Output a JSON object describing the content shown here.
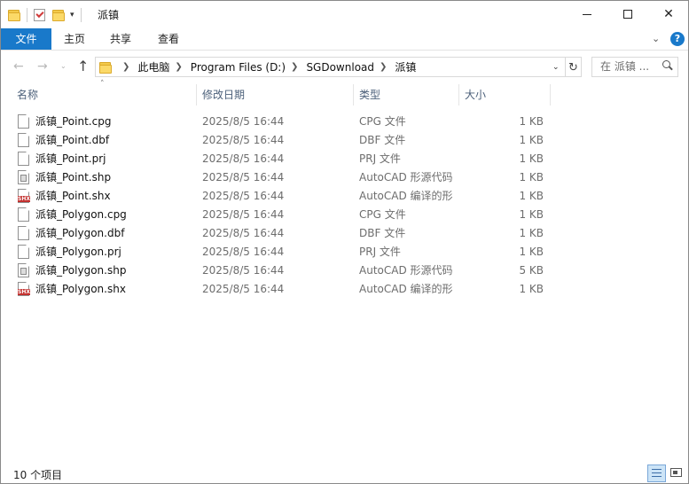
{
  "window": {
    "title": "派镇",
    "controls": {
      "minimize": "minimize",
      "maximize": "maximize",
      "close": "✕"
    }
  },
  "quick_access": {
    "dropdown": "▾"
  },
  "ribbon": {
    "tabs": [
      {
        "label": "文件",
        "active": true
      },
      {
        "label": "主页"
      },
      {
        "label": "共享"
      },
      {
        "label": "查看"
      }
    ],
    "expand": "⌄",
    "help": "?"
  },
  "navigation": {
    "back": "←",
    "forward": "→",
    "recent": "⌄",
    "up": "↑",
    "breadcrumb": [
      "此电脑",
      "Program Files (D:)",
      "SGDownload",
      "派镇"
    ],
    "address_dropdown": "⌄",
    "refresh": "↻",
    "search_placeholder": "在 派镇 ..."
  },
  "columns": [
    "名称",
    "修改日期",
    "类型",
    "大小"
  ],
  "sort_indicator": "˄",
  "files": [
    {
      "name": "派镇_Point.cpg",
      "date": "2025/8/5 16:44",
      "type": "CPG 文件",
      "size": "1 KB",
      "icon": "document-icon"
    },
    {
      "name": "派镇_Point.dbf",
      "date": "2025/8/5 16:44",
      "type": "DBF 文件",
      "size": "1 KB",
      "icon": "document-icon"
    },
    {
      "name": "派镇_Point.prj",
      "date": "2025/8/5 16:44",
      "type": "PRJ 文件",
      "size": "1 KB",
      "icon": "document-icon"
    },
    {
      "name": "派镇_Point.shp",
      "date": "2025/8/5 16:44",
      "type": "AutoCAD 形源代码",
      "size": "1 KB",
      "icon": "shape-file-icon"
    },
    {
      "name": "派镇_Point.shx",
      "date": "2025/8/5 16:44",
      "type": "AutoCAD 编译的形",
      "size": "1 KB",
      "icon": "shx-file-icon"
    },
    {
      "name": "派镇_Polygon.cpg",
      "date": "2025/8/5 16:44",
      "type": "CPG 文件",
      "size": "1 KB",
      "icon": "document-icon"
    },
    {
      "name": "派镇_Polygon.dbf",
      "date": "2025/8/5 16:44",
      "type": "DBF 文件",
      "size": "1 KB",
      "icon": "document-icon"
    },
    {
      "name": "派镇_Polygon.prj",
      "date": "2025/8/5 16:44",
      "type": "PRJ 文件",
      "size": "1 KB",
      "icon": "document-icon"
    },
    {
      "name": "派镇_Polygon.shp",
      "date": "2025/8/5 16:44",
      "type": "AutoCAD 形源代码",
      "size": "5 KB",
      "icon": "shape-file-icon"
    },
    {
      "name": "派镇_Polygon.shx",
      "date": "2025/8/5 16:44",
      "type": "AutoCAD 编译的形",
      "size": "1 KB",
      "icon": "shx-file-icon"
    }
  ],
  "shx_label": "SHX",
  "status": {
    "item_count": "10 个项目"
  },
  "colors": {
    "accent": "#1979ca",
    "header_text": "#4c607a",
    "meta_text": "#6d6d6d",
    "folder": "#fbd968",
    "shx_red": "#c3312f"
  }
}
